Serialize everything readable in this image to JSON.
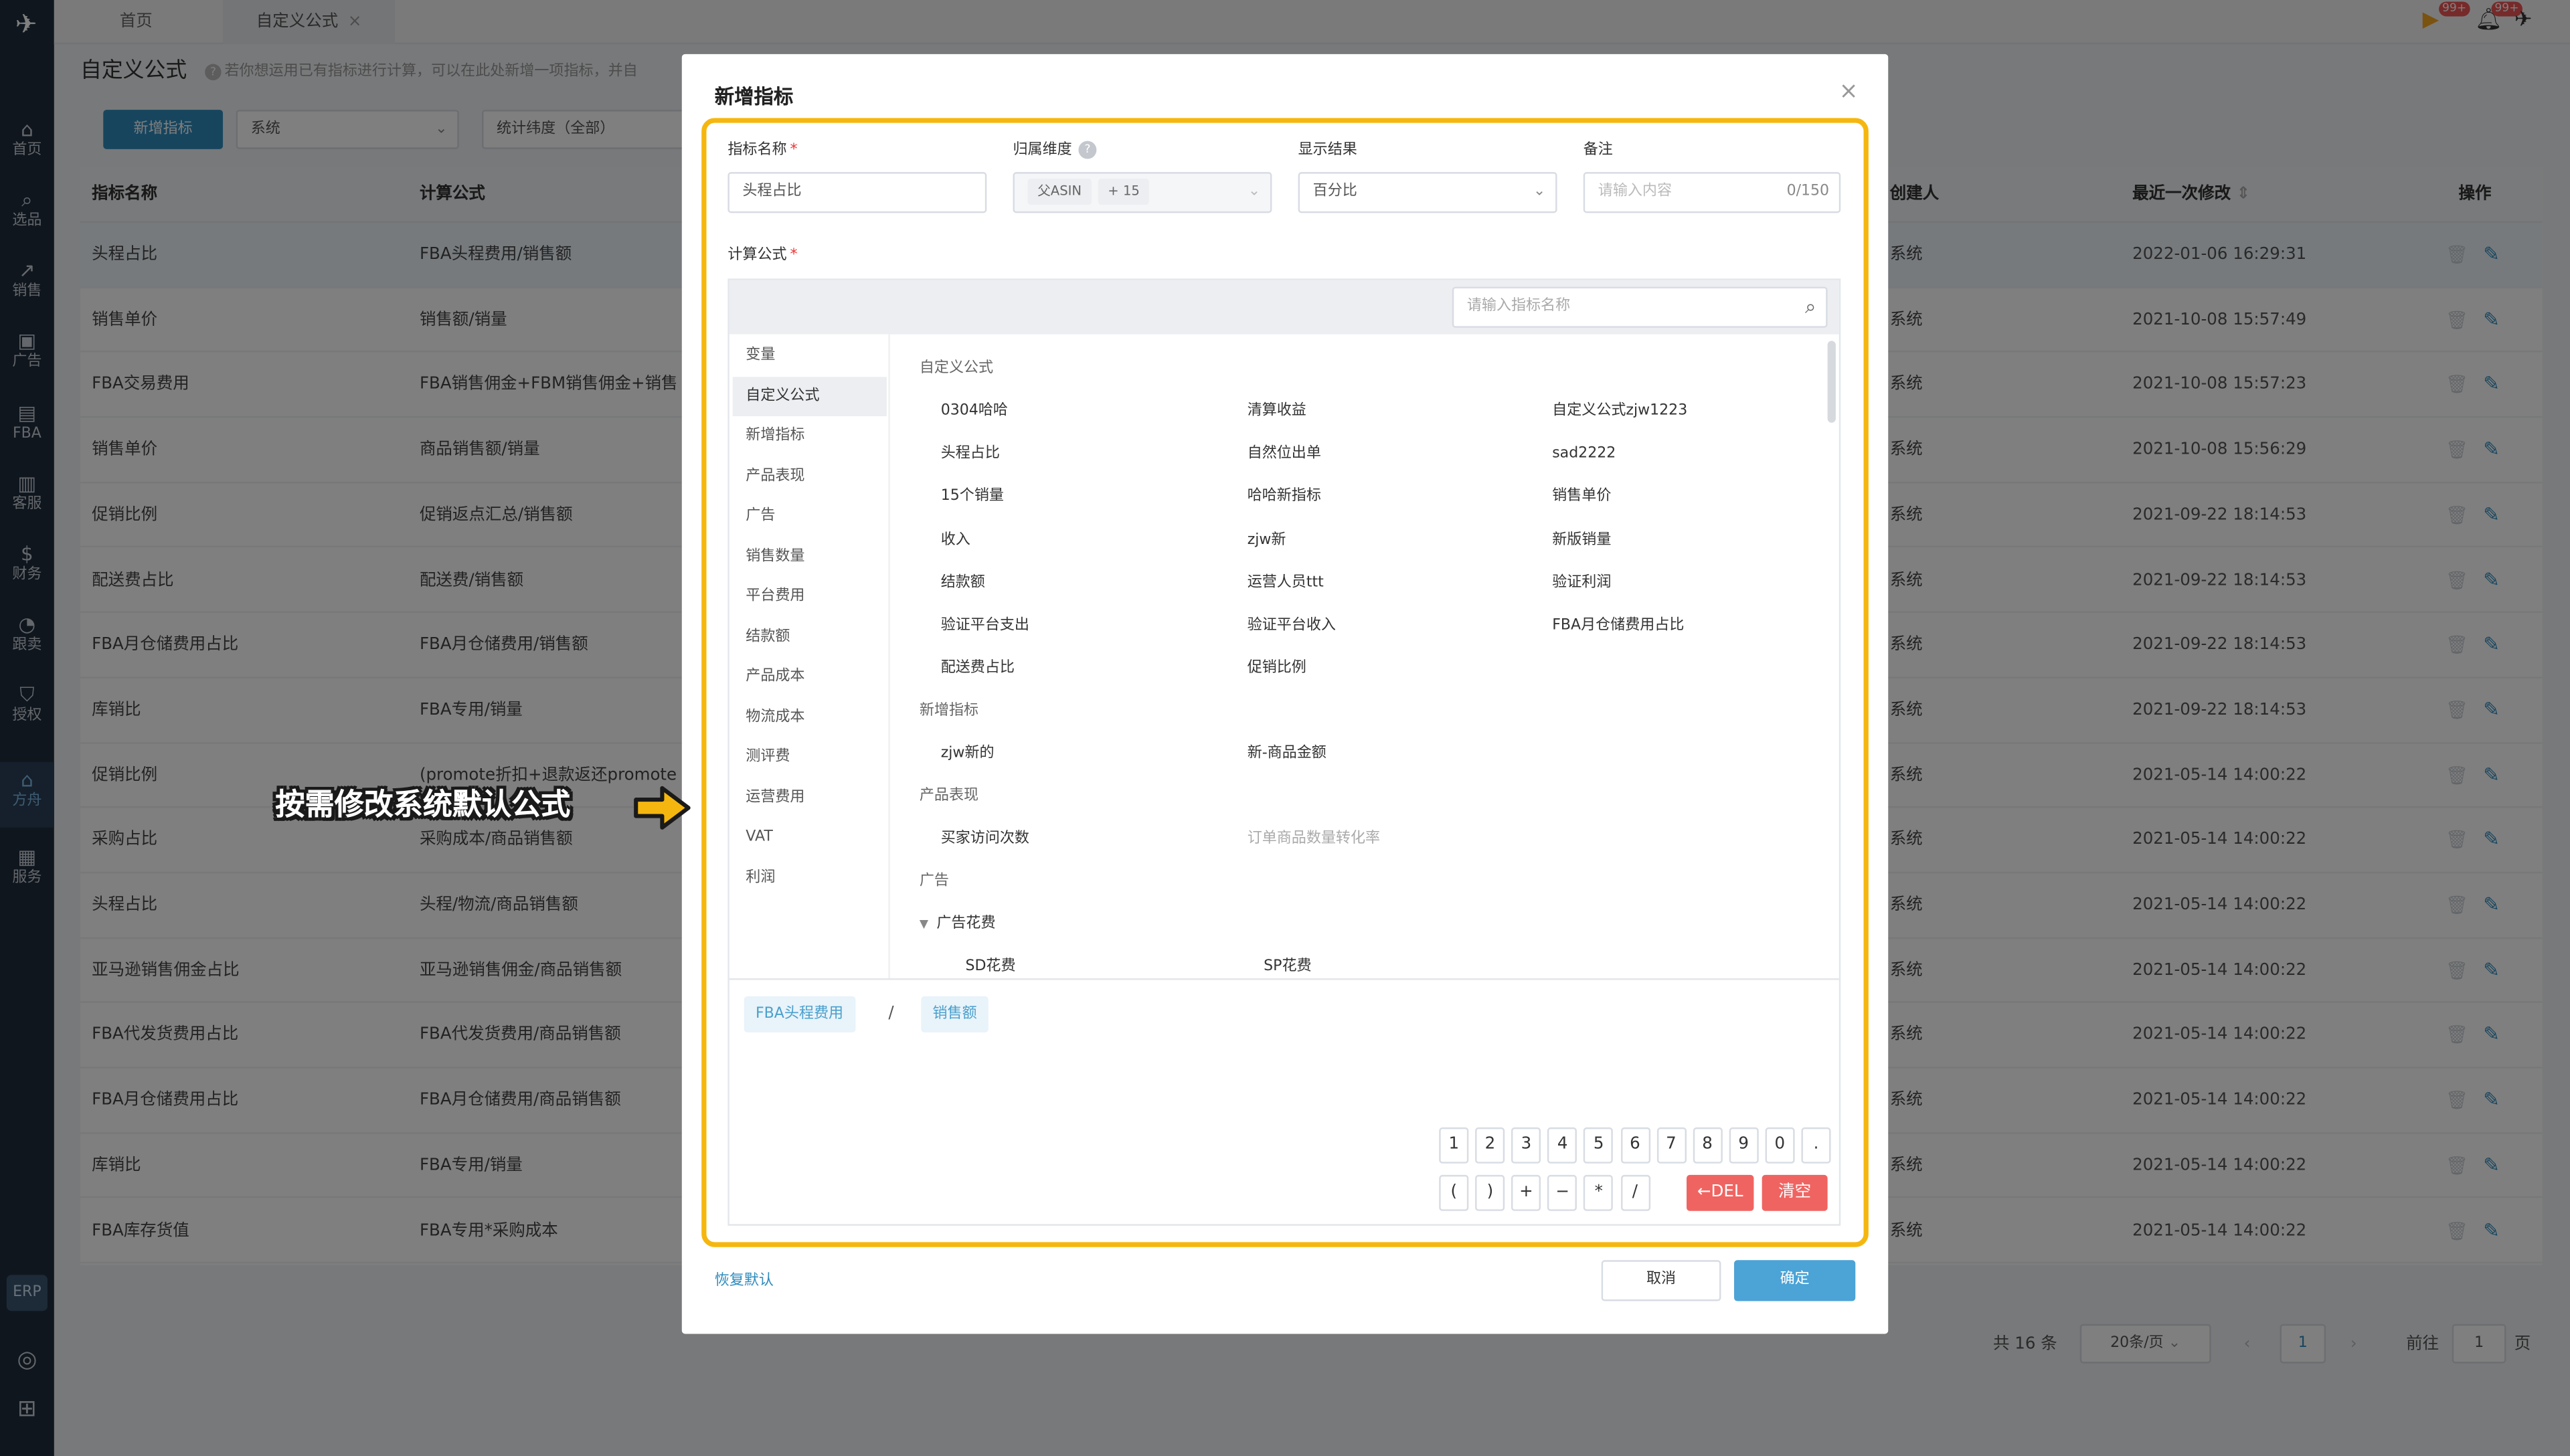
{
  "sidebar": {
    "items": [
      {
        "icon": "home-icon",
        "glyph": "⌂",
        "label": "首页"
      },
      {
        "icon": "search-icon",
        "glyph": "⌕",
        "label": "选品"
      },
      {
        "icon": "sales-chart-icon",
        "glyph": "↗",
        "label": "销售"
      },
      {
        "icon": "ad-icon",
        "glyph": "▣",
        "label": "广告"
      },
      {
        "icon": "fba-icon",
        "glyph": "▤",
        "label": "FBA"
      },
      {
        "icon": "service-icon",
        "glyph": "▥",
        "label": "客服"
      },
      {
        "icon": "finance-icon",
        "glyph": "$",
        "label": "财务"
      },
      {
        "icon": "pie-icon",
        "glyph": "◔",
        "label": "跟卖"
      },
      {
        "icon": "shield-icon",
        "glyph": "⛉",
        "label": "授权"
      },
      {
        "icon": "plan-icon",
        "glyph": "⌂",
        "label": "方舟"
      },
      {
        "icon": "service-bag-icon",
        "glyph": "▦",
        "label": "服务"
      }
    ],
    "erp": "ERP"
  },
  "tabs": {
    "home": "首页",
    "current": "自定义公式",
    "close": "×"
  },
  "badges": {
    "first": "99+",
    "second": "99+"
  },
  "page": {
    "title": "自定义公式",
    "hint": "若你想运用已有指标进行计算，可以在此处新增一项指标，并自",
    "add_button": "新增指标",
    "filter_source": "系统",
    "filter_dim": "统计纬度（全部）"
  },
  "table": {
    "headers": {
      "name": "指标名称",
      "formula": "计算公式",
      "creator": "创建人",
      "modified": "最近一次修改",
      "sort": "⇕",
      "ops": "操作"
    },
    "rows": [
      {
        "name": "头程占比",
        "formula": "FBA头程费用/销售额",
        "creator": "系统",
        "time": "2022-01-06 16:29:31"
      },
      {
        "name": "销售单价",
        "formula": "销售额/销量",
        "creator": "系统",
        "time": "2021-10-08 15:57:49"
      },
      {
        "name": "FBA交易费用",
        "formula": "FBA销售佣金+FBM销售佣金+销售",
        "creator": "系统",
        "time": "2021-10-08 15:57:23"
      },
      {
        "name": "销售单价",
        "formula": "商品销售额/销量",
        "creator": "系统",
        "time": "2021-10-08 15:56:29"
      },
      {
        "name": "促销比例",
        "formula": "促销返点汇总/销售额",
        "creator": "系统",
        "time": "2021-09-22 18:14:53"
      },
      {
        "name": "配送费占比",
        "formula": "配送费/销售额",
        "creator": "系统",
        "time": "2021-09-22 18:14:53"
      },
      {
        "name": "FBA月仓储费用占比",
        "formula": "FBA月仓储费用/销售额",
        "creator": "系统",
        "time": "2021-09-22 18:14:53"
      },
      {
        "name": "库销比",
        "formula": "FBA专用/销量",
        "creator": "系统",
        "time": "2021-09-22 18:14:53"
      },
      {
        "name": "促销比例",
        "formula": "(promote折扣+退款返还promote",
        "creator": "系统",
        "time": "2021-05-14 14:00:22"
      },
      {
        "name": "采购占比",
        "formula": "采购成本/商品销售额",
        "creator": "系统",
        "time": "2021-05-14 14:00:22"
      },
      {
        "name": "头程占比",
        "formula": "头程/物流/商品销售额",
        "creator": "系统",
        "time": "2021-05-14 14:00:22"
      },
      {
        "name": "亚马逊销售佣金占比",
        "formula": "亚马逊销售佣金/商品销售额",
        "creator": "系统",
        "time": "2021-05-14 14:00:22"
      },
      {
        "name": "FBA代发货费用占比",
        "formula": "FBA代发货费用/商品销售额",
        "creator": "系统",
        "time": "2021-05-14 14:00:22"
      },
      {
        "name": "FBA月仓储费用占比",
        "formula": "FBA月仓储费用/商品销售额",
        "creator": "系统",
        "time": "2021-05-14 14:00:22"
      },
      {
        "name": "库销比",
        "formula": "FBA专用/销量",
        "creator": "系统",
        "time": "2021-05-14 14:00:22"
      },
      {
        "name": "FBA库存货值",
        "formula": "FBA专用*采购成本",
        "creator": "系统",
        "time": "2021-05-14 14:00:22"
      }
    ]
  },
  "pagination": {
    "total": "共 16 条",
    "page_size": "20条/页",
    "current": "1",
    "goto_label": "前往",
    "goto_value": "1",
    "page_suffix": "页",
    "prev": "‹",
    "next": "›"
  },
  "modal": {
    "title": "新增指标",
    "close": "×",
    "fields": {
      "name_label": "指标名称",
      "name_value": "头程占比",
      "dim_label": "归属维度",
      "dim_tag1": "父ASIN",
      "dim_tag2": "+ 15",
      "result_label": "显示结果",
      "result_value": "百分比",
      "remark_label": "备注",
      "remark_placeholder": "请输入内容",
      "remark_count": "0/150"
    },
    "formula_label": "计算公式",
    "search_placeholder": "请输入指标名称",
    "categories": [
      "变量",
      "自定义公式",
      "新增指标",
      "产品表现",
      "广告",
      "销售数量",
      "平台费用",
      "结款额",
      "产品成本",
      "物流成本",
      "测评费",
      "运营费用",
      "VAT",
      "利润"
    ],
    "groups": {
      "custom": "自定义公式",
      "custom_items": [
        "0304哈哈",
        "清算收益",
        "自定义公式zjw1223",
        "头程占比",
        "自然位出单",
        "sad2222",
        "15个销量",
        "哈哈新指标",
        "销售单价",
        "收入",
        "zjw新",
        "新版销量",
        "结款额",
        "运营人员ttt",
        "验证利润",
        "验证平台支出",
        "验证平台收入",
        "FBA月仓储费用占比",
        "配送费占比",
        "促销比例"
      ],
      "new": "新增指标",
      "new_items": [
        "zjw新的",
        "新-商品金额"
      ],
      "product": "产品表现",
      "product_items": [
        "买家访问次数",
        "订单商品数量转化率"
      ],
      "ads": "广告",
      "ads_sub": "广告花费",
      "ads_items": [
        "SD花费",
        "SP花费"
      ]
    },
    "expression": {
      "chip1": "FBA头程费用",
      "op": "/",
      "chip2": "销售额"
    },
    "keypad": {
      "row1": [
        "1",
        "2",
        "3",
        "4",
        "5",
        "6",
        "7",
        "8",
        "9",
        "0",
        "."
      ],
      "row2": [
        "(",
        ")",
        "+",
        "−",
        "*",
        "/"
      ],
      "del": "←DEL",
      "clear": "清空"
    },
    "restore": "恢复默认",
    "cancel": "取消",
    "ok": "确定"
  },
  "annotation": {
    "text": "按需修改系统默认公式",
    "color": "#f5b70f"
  }
}
